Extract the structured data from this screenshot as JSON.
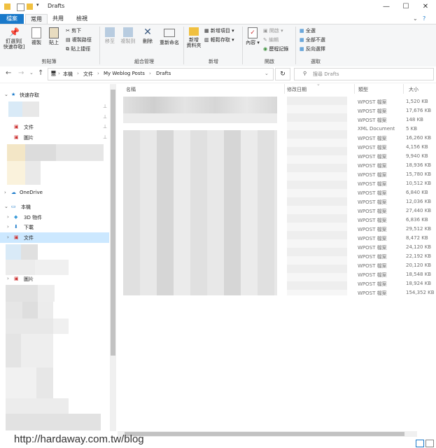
{
  "window": {
    "title": "Drafts"
  },
  "ribbon_tabs": [
    "檔案",
    "常用",
    "共用",
    "檢視"
  ],
  "ribbon": {
    "pin_label": "釘選到[\n快速存取]",
    "copy_label": "複製",
    "paste_label": "貼上",
    "cut_label": "剪下",
    "copy_path_label": "複製路徑",
    "paste_shortcut_label": "貼上捷徑",
    "clipboard_group": "剪貼簿",
    "move_to_label": "移至",
    "copy_to_label": "複製到",
    "delete_label": "刪除",
    "rename_label": "重新命名",
    "organize_group": "組合管理",
    "new_folder_label": "新增\n資料夾",
    "new_item_label": "新增項目",
    "easy_access_label": "輕鬆存取",
    "new_group": "新增",
    "properties_label": "內容",
    "open_label": "開啟",
    "edit_label": "編輯",
    "history_label": "歷程記錄",
    "open_group": "開啟",
    "select_all_label": "全選",
    "select_none_label": "全部不選",
    "invert_label": "反向選擇",
    "select_group": "選取"
  },
  "address": {
    "crumbs": [
      "本機",
      "文件",
      "My Weblog Posts",
      "Drafts"
    ],
    "search_placeholder": "搜尋 Drafts"
  },
  "nav": {
    "quick_access": "快速存取",
    "documents": "文件",
    "pictures": "圖片",
    "onedrive": "OneDrive",
    "this_pc": "本機",
    "objects3d": "3D 物件",
    "downloads": "下載",
    "documents2": "文件",
    "pictures2": "圖片"
  },
  "columns": {
    "name": "名稱",
    "date": "修改日期",
    "type": "類型",
    "size": "大小"
  },
  "files": [
    {
      "type": "WPOST 檔案",
      "size": "1,520 KB"
    },
    {
      "type": "WPOST 檔案",
      "size": "17,676 KB"
    },
    {
      "type": "WPOST 檔案",
      "size": "148 KB"
    },
    {
      "type": "XML Document",
      "size": "5 KB"
    },
    {
      "type": "WPOST 檔案",
      "size": "16,260 KB"
    },
    {
      "type": "WPOST 檔案",
      "size": "4,156 KB"
    },
    {
      "type": "WPOST 檔案",
      "size": "9,940 KB"
    },
    {
      "type": "WPOST 檔案",
      "size": "18,936 KB"
    },
    {
      "type": "WPOST 檔案",
      "size": "15,780 KB"
    },
    {
      "type": "WPOST 檔案",
      "size": "10,512 KB"
    },
    {
      "type": "WPOST 檔案",
      "size": "6,840 KB"
    },
    {
      "type": "WPOST 檔案",
      "size": "12,036 KB"
    },
    {
      "type": "WPOST 檔案",
      "size": "27,440 KB"
    },
    {
      "type": "WPOST 檔案",
      "size": "6,836 KB"
    },
    {
      "type": "WPOST 檔案",
      "size": "29,512 KB"
    },
    {
      "type": "WPOST 檔案",
      "size": "8,472 KB"
    },
    {
      "type": "WPOST 檔案",
      "size": "24,120 KB"
    },
    {
      "type": "WPOST 檔案",
      "size": "22,192 KB"
    },
    {
      "type": "WPOST 檔案",
      "size": "20,120 KB"
    },
    {
      "type": "WPOST 檔案",
      "size": "18,548 KB"
    },
    {
      "type": "WPOST 檔案",
      "size": "18,924 KB"
    },
    {
      "type": "WPOST 檔案",
      "size": "154,352 KB"
    }
  ],
  "watermark": "http://hardaway.com.tw/blog",
  "colors": {
    "accent": "#1979ca",
    "selected": "#cce8ff",
    "folder": "#f0c040"
  }
}
